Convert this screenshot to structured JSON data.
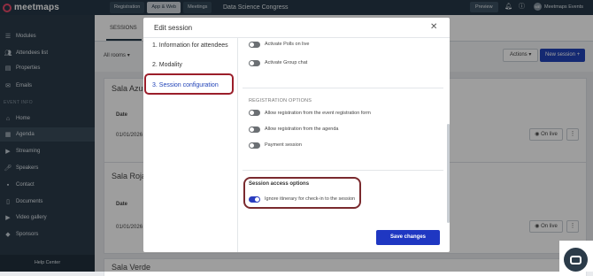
{
  "app": {
    "logo_text": "meetmaps",
    "event_name": "Data Science Congress",
    "user_name": "Meetmaps Events",
    "avatar_initials": "ME"
  },
  "topbar": {
    "tabs": [
      {
        "label": "Registration"
      },
      {
        "label": "App & Web"
      },
      {
        "label": "Meetings"
      }
    ],
    "preview_label": "Preview",
    "language": "EN"
  },
  "sidebar": {
    "items": [
      {
        "label": "Modules",
        "icon": "grid-icon"
      },
      {
        "label": "Attendees list",
        "icon": "users-icon"
      },
      {
        "label": "Properties",
        "icon": "properties-icon"
      },
      {
        "label": "Emails",
        "icon": "mail-icon"
      }
    ],
    "section_label": "EVENT INFO",
    "event_items": [
      {
        "label": "Home",
        "icon": "home-icon"
      },
      {
        "label": "Agenda",
        "icon": "calendar-icon"
      },
      {
        "label": "Streaming",
        "icon": "video-icon"
      },
      {
        "label": "Speakers",
        "icon": "mic-icon"
      },
      {
        "label": "Contact",
        "icon": "contact-icon"
      },
      {
        "label": "Documents",
        "icon": "document-icon"
      },
      {
        "label": "Video gallery",
        "icon": "video-gallery-icon"
      },
      {
        "label": "Sponsors",
        "icon": "sponsor-icon"
      }
    ],
    "help_label": "Help Center"
  },
  "main": {
    "subtab_label": "SESSIONS",
    "rooms_filter": "All rooms",
    "actions_label": "Actions",
    "new_session_label": "New session",
    "rooms": [
      {
        "title": "Sala Azul",
        "date_header": "Date",
        "date": "01/01/2026",
        "button": "On live"
      },
      {
        "title": "Sala Roja",
        "date_header": "Date",
        "date": "01/01/2026",
        "button": "On live"
      },
      {
        "title": "Sala Verde"
      }
    ]
  },
  "modal": {
    "title": "Edit session",
    "steps": [
      {
        "label": "1. Information for attendees"
      },
      {
        "label": "2. Modality"
      },
      {
        "label": "3. Session configuration"
      }
    ],
    "top_options": [
      {
        "label": "Activate Polls on live",
        "on": false
      },
      {
        "label": "Activate Group chat",
        "on": false
      }
    ],
    "registration_heading": "REGISTRATION OPTIONS",
    "registration_options": [
      {
        "label": "Allow registration from the event registration form",
        "on": false
      },
      {
        "label": "Allow registration from the agenda",
        "on": false
      },
      {
        "label": "Payment session",
        "on": false
      }
    ],
    "access_heading": "Session access options",
    "access_options": [
      {
        "label": "Ignore itinerary for check-in to the session",
        "on": true
      }
    ],
    "save_label": "Save changes"
  },
  "colors": {
    "primary": "#1f37c2",
    "topbar": "#263847",
    "sidebar": "#2b3b49",
    "highlight": "#9b1e2a"
  }
}
